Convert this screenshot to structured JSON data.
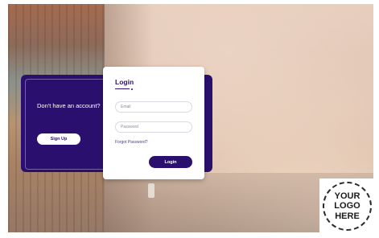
{
  "signup": {
    "prompt": "Don't have an account?",
    "button_label": "Sign Up"
  },
  "login": {
    "title": "Login",
    "email_placeholder": "Email",
    "password_placeholder": "Password",
    "forgot_link": "Forgot Password?",
    "button_label": "Login"
  },
  "logo": {
    "text": "YOUR LOGO HERE"
  },
  "colors": {
    "accent": "#2b0f6e",
    "card_background": "#ffffff"
  }
}
